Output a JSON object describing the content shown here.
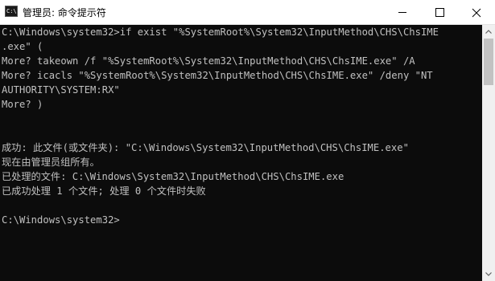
{
  "window": {
    "icon_text": "C:\\",
    "title": "管理员: 命令提示符"
  },
  "console": {
    "lines": [
      "C:\\Windows\\system32>if exist \"%SystemRoot%\\System32\\InputMethod\\CHS\\ChsIME",
      ".exe\" (",
      "More? takeown /f \"%SystemRoot%\\System32\\InputMethod\\CHS\\ChsIME.exe\" /A",
      "More? icacls \"%SystemRoot%\\System32\\InputMethod\\CHS\\ChsIME.exe\" /deny \"NT",
      "AUTHORITY\\SYSTEM:RX\"",
      "More? )",
      "",
      "",
      "成功: 此文件(或文件夹): \"C:\\Windows\\System32\\InputMethod\\CHS\\ChsIME.exe\"",
      "现在由管理员组所有。",
      "已处理的文件: C:\\Windows\\System32\\InputMethod\\CHS\\ChsIME.exe",
      "已成功处理 1 个文件; 处理 0 个文件时失败",
      "",
      "C:\\Windows\\system32>"
    ]
  },
  "icons": {
    "app": "cmd-icon",
    "minimize": "minimize-icon",
    "maximize": "maximize-icon",
    "close": "close-icon",
    "scroll_up": "arrow-up-icon",
    "scroll_down": "arrow-down-icon"
  },
  "colors": {
    "console_background": "#0c0c0c",
    "console_text": "#c0c0c0",
    "titlebar": "#ffffff",
    "scrollbar_track": "#f0f0f0",
    "scrollbar_thumb": "#c2c2c2"
  }
}
